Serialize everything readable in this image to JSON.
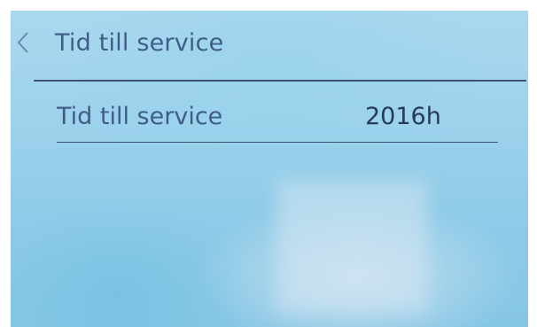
{
  "header": {
    "title": "Tid till service",
    "back_icon": "chevron-left-icon"
  },
  "settings": [
    {
      "label": "Tid till service",
      "value": "2016h"
    }
  ],
  "colors": {
    "text": "#3f5d87",
    "value_text": "#253a5c",
    "divider": "#3b5275",
    "background": "#9dd2ec"
  }
}
